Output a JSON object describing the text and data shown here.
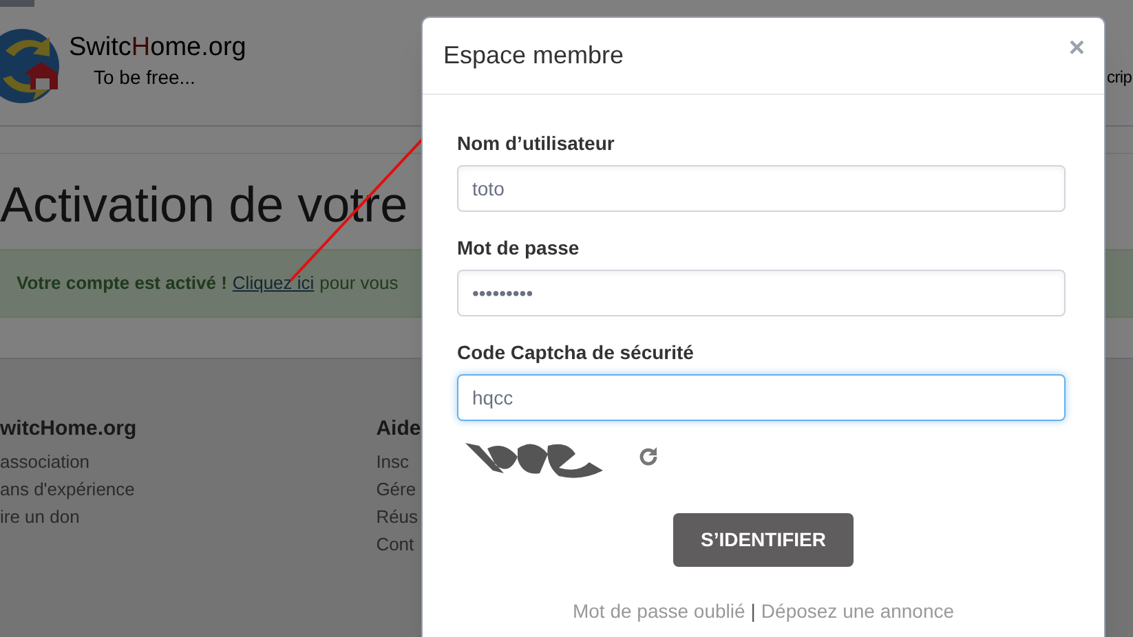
{
  "background_page": {
    "logo": {
      "brand_parts": [
        "Switc",
        "H",
        "ome.org"
      ],
      "tagline": "To be free..."
    },
    "header_link": "crip",
    "heading": "Activation de votre",
    "alert": {
      "strong": "Votre compte est activé !",
      "link": "Cliquez ici",
      "rest": "pour vous"
    },
    "footer_columns": [
      {
        "title": "witcHome.org",
        "links": [
          "association",
          "ans d'expérience",
          "ire un don"
        ]
      },
      {
        "title": "Aide",
        "links": [
          "Insc",
          "Gére",
          "Réus",
          "Cont"
        ]
      }
    ]
  },
  "modal": {
    "title": "Espace membre",
    "close": "×",
    "fields": [
      {
        "label": "Nom d’utilisateur",
        "value": "toto",
        "focused": false
      },
      {
        "label": "Mot de passe",
        "value": "•••••••••",
        "focused": false
      },
      {
        "label": "Code Captcha de sécurité",
        "value": "hqcc",
        "focused": true
      }
    ],
    "submit": "S’IDENTIFIER",
    "footer_links": [
      "Mot de passe oublié",
      "Déposez une annonce"
    ],
    "separator": "|"
  }
}
